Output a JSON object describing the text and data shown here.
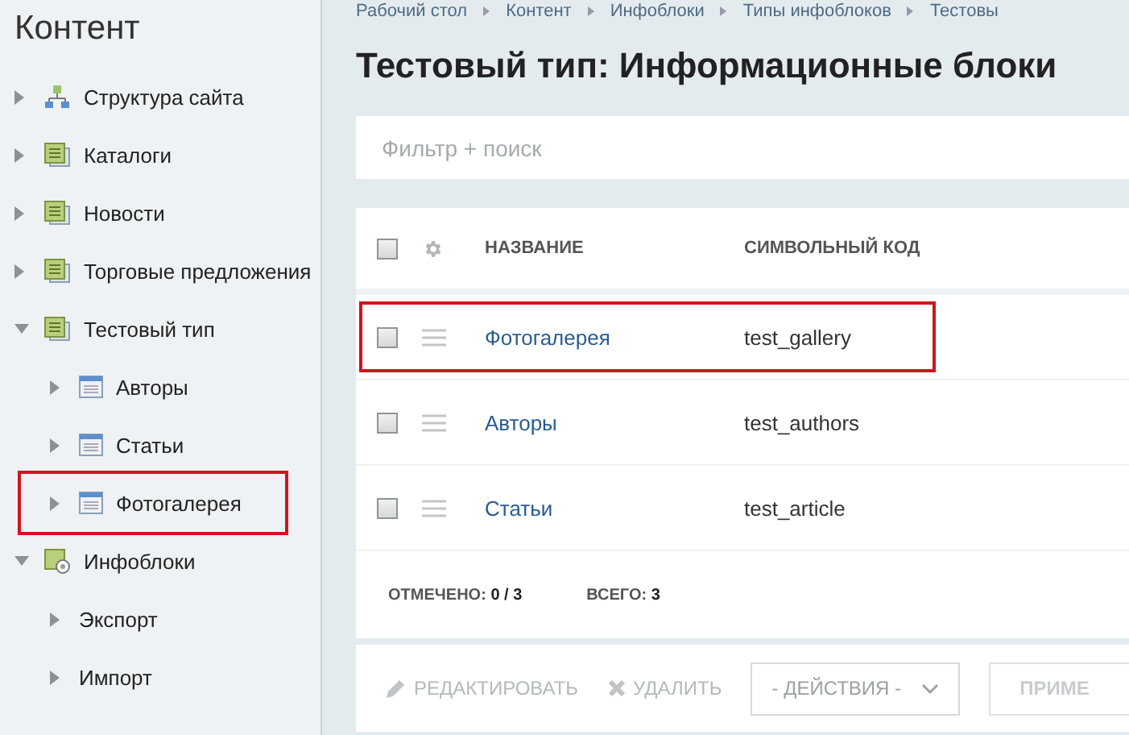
{
  "sidebar": {
    "title": "Контент",
    "items": [
      {
        "label": "Структура сайта",
        "kind": "structure",
        "expanded": false,
        "highlighted": false
      },
      {
        "label": "Каталоги",
        "kind": "section",
        "expanded": false,
        "highlighted": false
      },
      {
        "label": "Новости",
        "kind": "section",
        "expanded": false,
        "highlighted": false
      },
      {
        "label": "Торговые предложения",
        "kind": "section",
        "expanded": false,
        "highlighted": false
      },
      {
        "label": "Тестовый тип",
        "kind": "section",
        "expanded": true,
        "highlighted": false,
        "children": [
          {
            "label": "Авторы",
            "kind": "iblock",
            "expanded": false,
            "highlighted": false
          },
          {
            "label": "Статьи",
            "kind": "iblock",
            "expanded": false,
            "highlighted": false
          },
          {
            "label": "Фотогалерея",
            "kind": "iblock",
            "expanded": false,
            "highlighted": true
          }
        ]
      },
      {
        "label": "Инфоблоки",
        "kind": "settings",
        "expanded": true,
        "highlighted": false,
        "children": [
          {
            "label": "Экспорт",
            "kind": "plain",
            "expanded": false,
            "highlighted": false
          },
          {
            "label": "Импорт",
            "kind": "plain",
            "expanded": false,
            "highlighted": false
          }
        ]
      }
    ]
  },
  "breadcrumbs": [
    "Рабочий стол",
    "Контент",
    "Инфоблоки",
    "Типы инфоблоков",
    "Тестовы"
  ],
  "title": "Тестовый тип: Информационные блоки",
  "search": {
    "placeholder": "Фильтр + поиск"
  },
  "table": {
    "all_checked": false,
    "columns": [
      "НАЗВАНИЕ",
      "СИМВОЛЬНЫЙ КОД"
    ],
    "rows": [
      {
        "name": "Фотогалерея",
        "code": "test_gallery",
        "checked": false,
        "highlighted": true
      },
      {
        "name": "Авторы",
        "code": "test_authors",
        "checked": false,
        "highlighted": false
      },
      {
        "name": "Статьи",
        "code": "test_article",
        "checked": false,
        "highlighted": false
      }
    ],
    "footer": {
      "selected_label": "ОТМЕЧЕНО:",
      "selected_value": "0 / 3",
      "total_label": "ВСЕГО:",
      "total_value": "3"
    }
  },
  "actions": {
    "edit": "РЕДАКТИРОВАТЬ",
    "delete": "УДАЛИТЬ",
    "dropdown": "- ДЕЙСТВИЯ -",
    "apply": "ПРИМЕ"
  }
}
